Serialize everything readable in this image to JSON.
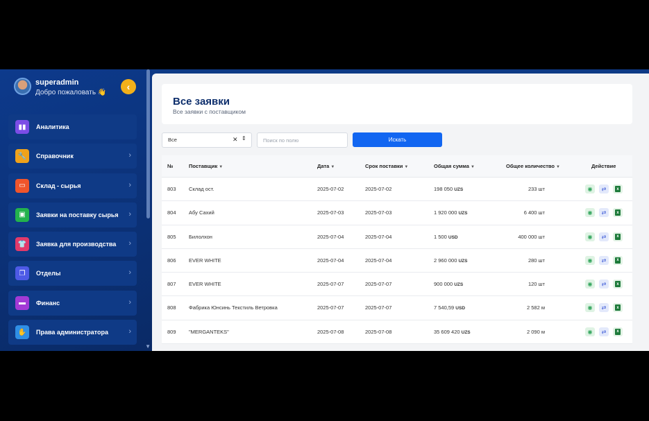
{
  "profile": {
    "username": "superadmin",
    "welcome": "Добро пожаловать 👋"
  },
  "sidebar": {
    "items": [
      {
        "label": "Аналитика",
        "icon": "chart-icon",
        "color": "#7b4de6",
        "glyph": "▮▮"
      },
      {
        "label": "Справочник",
        "icon": "wrench-icon",
        "color": "#f0a21a",
        "glyph": "🔧"
      },
      {
        "label": "Склад - сырья",
        "icon": "box-icon",
        "color": "#f0552b",
        "glyph": "▭"
      },
      {
        "label": "Заявки на поставку сырья",
        "icon": "bus-icon",
        "color": "#23b24d",
        "glyph": "▣"
      },
      {
        "label": "Заявка для производства",
        "icon": "shirt-icon",
        "color": "#e23a6a",
        "glyph": "👕"
      },
      {
        "label": "Отделы",
        "icon": "copy-icon",
        "color": "#4d5ae6",
        "glyph": "❐"
      },
      {
        "label": "Финанс",
        "icon": "card-icon",
        "color": "#a23ad6",
        "glyph": "▬"
      },
      {
        "label": "Права администратора",
        "icon": "hand-icon",
        "color": "#2f8fe6",
        "glyph": "✋"
      }
    ]
  },
  "page": {
    "title": "Все заявки",
    "subtitle": "Все заявки с поставщиком"
  },
  "filter": {
    "selected": "Все",
    "search_placeholder": "Поиск по полю",
    "search_button": "Искать"
  },
  "table": {
    "headers": {
      "num": "№",
      "supplier": "Поставщик",
      "date": "Дата",
      "deadline": "Срок поставки",
      "total": "Общая сумма",
      "qty": "Общее количество",
      "action": "Действие"
    },
    "rows": [
      {
        "num": "803",
        "supplier": "Склад ост.",
        "date": "2025-07-02",
        "deadline": "2025-07-02",
        "amount": "198 050",
        "currency": "UZS",
        "qty": "233 шт"
      },
      {
        "num": "804",
        "supplier": "Абу Сахий",
        "date": "2025-07-03",
        "deadline": "2025-07-03",
        "amount": "1 920 000",
        "currency": "UZS",
        "qty": "6 400 шт"
      },
      {
        "num": "805",
        "supplier": "Билолхон",
        "date": "2025-07-04",
        "deadline": "2025-07-04",
        "amount": "1 500",
        "currency": "USD",
        "qty": "400 000 шт"
      },
      {
        "num": "806",
        "supplier": "EVER WHITE",
        "date": "2025-07-04",
        "deadline": "2025-07-04",
        "amount": "2 960 000",
        "currency": "UZS",
        "qty": "280 шт"
      },
      {
        "num": "807",
        "supplier": "EVER WHITE",
        "date": "2025-07-07",
        "deadline": "2025-07-07",
        "amount": "900 000",
        "currency": "UZS",
        "qty": "120 шт"
      },
      {
        "num": "808",
        "supplier": "Фабрика Юнсинь Текстиль Ветровка",
        "date": "2025-07-07",
        "deadline": "2025-07-07",
        "amount": "7 540,59",
        "currency": "USD",
        "qty": "2 582 м"
      },
      {
        "num": "809",
        "supplier": "\"MERGANTEKS\"",
        "date": "2025-07-08",
        "deadline": "2025-07-08",
        "amount": "35 609 420",
        "currency": "UZS",
        "qty": "2 090 м"
      }
    ]
  }
}
